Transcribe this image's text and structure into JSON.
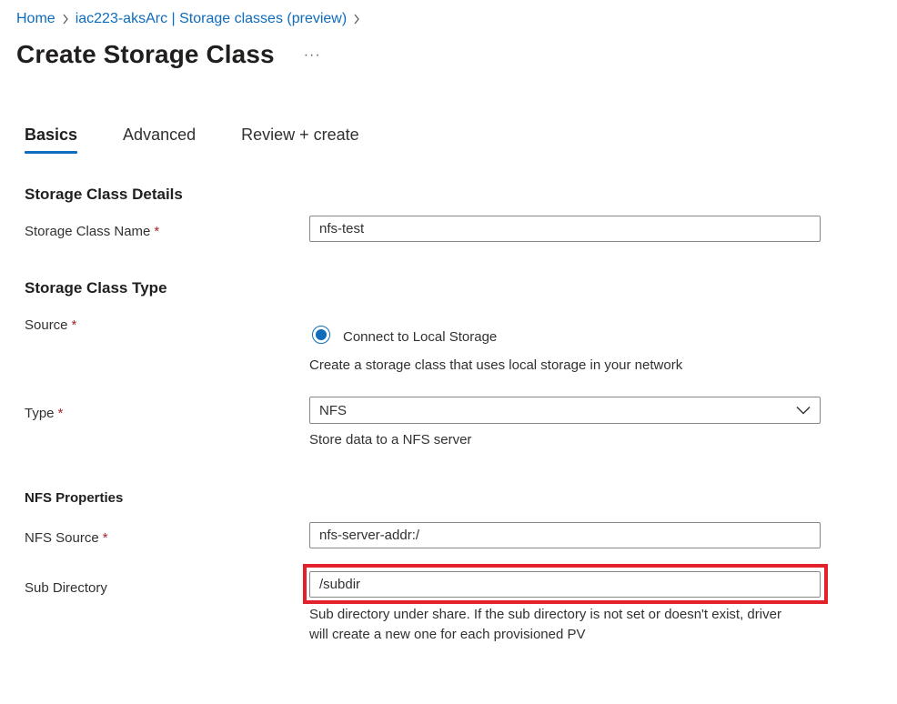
{
  "breadcrumb": {
    "items": [
      "Home",
      "iac223-aksArc | Storage classes (preview)"
    ]
  },
  "title": "Create Storage Class",
  "more_label": "···",
  "tabs": [
    {
      "label": "Basics",
      "active": true
    },
    {
      "label": "Advanced",
      "active": false
    },
    {
      "label": "Review + create",
      "active": false
    }
  ],
  "details": {
    "section_title": "Storage Class Details",
    "name_label": "Storage Class Name",
    "name_value": "nfs-test"
  },
  "type_section": {
    "section_title": "Storage Class Type",
    "source_label": "Source",
    "source_option": "Connect to Local Storage",
    "source_helper": "Create a storage class that uses local storage in your network",
    "type_label": "Type",
    "type_value": "NFS",
    "type_helper": "Store data to a NFS server"
  },
  "nfs": {
    "section_title": "NFS Properties",
    "source_label": "NFS Source",
    "source_value": "nfs-server-addr:/",
    "subdir_label": "Sub Directory",
    "subdir_value": "/subdir",
    "subdir_helper_line1": "Sub directory under share. If the sub directory is not set or doesn't exist, driver",
    "subdir_helper_line2": "will create a new one for each provisioned PV"
  },
  "required_marker": "*",
  "colors": {
    "link": "#0f6cbd",
    "required": "#a4262c",
    "highlight": "#e3212b",
    "border": "#8a8886"
  }
}
